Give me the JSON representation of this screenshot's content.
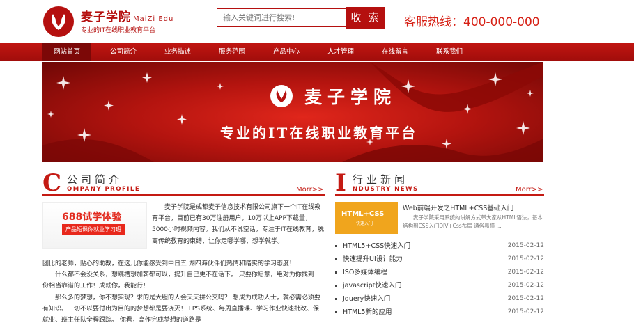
{
  "header": {
    "brand_cn": "麦子学院",
    "brand_en": "MaiZi Edu",
    "slogan": "专业的IT在线职业教育平台",
    "search_placeholder": "输入关键词进行搜索!",
    "search_button": "收 索",
    "hotline": "客服热线：400-000-000"
  },
  "nav": {
    "items": [
      "网站首页",
      "公司简介",
      "业务描述",
      "服务范围",
      "产品中心",
      "人才管理",
      "在线留言",
      "联系我们"
    ],
    "active_index": 0
  },
  "banner": {
    "title": "麦子学院",
    "subtitle": "专业的IT在线职业教育平台"
  },
  "about": {
    "letter": "C",
    "title": "公司简介",
    "en": "OMPANY PROFILE",
    "more": "Morr>>",
    "image_title": "688试学体验",
    "image_tag": "产品短课你就业学习班",
    "p1": "麦子学院是成都麦子信息技术有限公司旗下一个IT在线教育平台，目前已有30万注册用户，10万以上APP下载量，5000小时视频内容。我们从不说空话，专注于IT在线教育，脱离传统教育的束缚，让你走哪学哪，想学就学。",
    "p1_tail": "团比的老师，贴心的助教，在这儿你能感受到中日五 湖四海伙伴们热情和踏实的学习态度！",
    "p2": "什么都不会没关系，想跳槽想加薪都可以，提升自己更不在话下。 只要你愿意，绝对为你找到一份相当靠谱的工作！成就你，我能行！",
    "p3": "那么多的梦想，你不想实现？求的是大胆的人会天天拼公交吗？ 想成为成功人士，就必需必须要有知识。一切不以要付出为目的的梦想都是要浇灭！ LPS系统、每周直播课、学习作业快速批改、保就业、班主任队全程跟踪。 你看，高作完成梦想的道路是"
  },
  "news": {
    "letter": "I",
    "title": "行业新闻",
    "en": "NDUSTRY NEWS",
    "more": "Morr>>",
    "image_label": "HTML+CSS",
    "image_sub": "快速入门",
    "featured_title": "Web前端开发之HTML+CSS基础入门",
    "featured_desc": "麦子学院采用系统的讲解方式带大家从HTML语法，基本结构到CSS入门DIV+Css布局 通俗易懂 ...",
    "items": [
      {
        "title": "HTML5+CSS快速入门",
        "date": "2015-02-12"
      },
      {
        "title": "快速提升UI设计能力",
        "date": "2015-02-12"
      },
      {
        "title": "ISO多媒体编程",
        "date": "2015-02-12"
      },
      {
        "title": "javascript快速入门",
        "date": "2015-02-12"
      },
      {
        "title": "Jquery快速入门",
        "date": "2015-02-12"
      },
      {
        "title": "HTML5新的应用",
        "date": "2015-02-12"
      }
    ]
  },
  "colors": {
    "brand_red": "#b5100f",
    "accent_red": "#c41a13",
    "hotline_red": "#d62015"
  }
}
